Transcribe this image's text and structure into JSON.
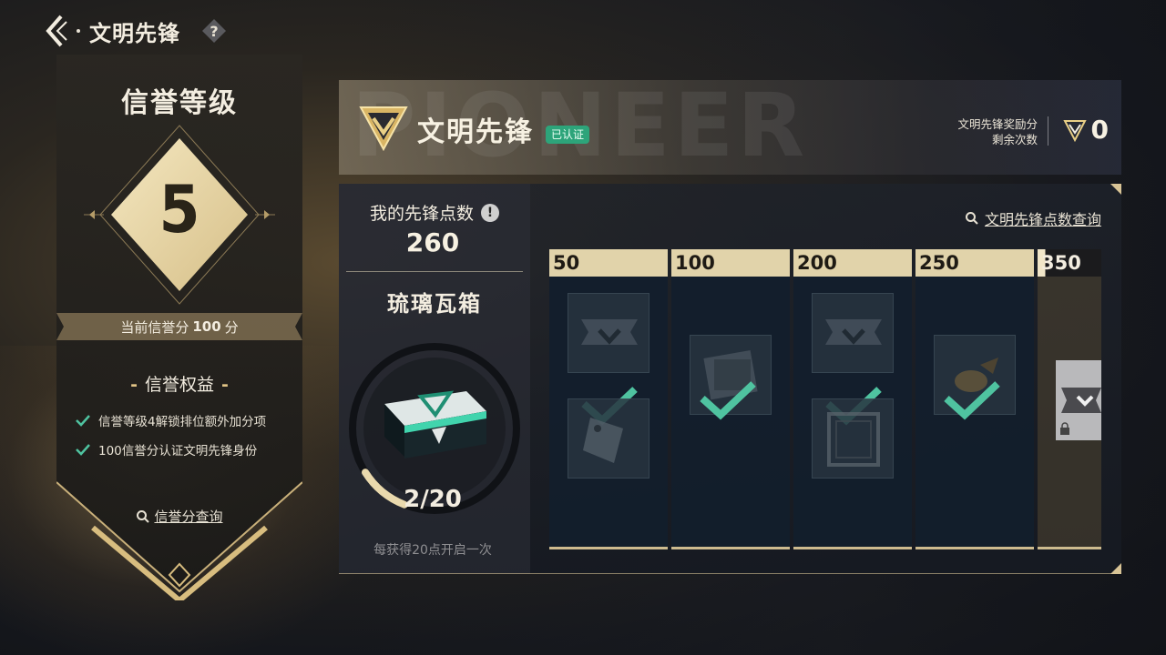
{
  "topbar": {
    "title": "文明先锋"
  },
  "rank": {
    "title": "信誉等级",
    "level": "5",
    "score_prefix": "当前信誉分",
    "score_value": "100",
    "score_suffix": "分",
    "benefits_title": "信誉权益",
    "benefits": [
      "信誉等级4解锁排位额外加分项",
      "100信誉分认证文明先锋身份"
    ],
    "query_label": "信誉分查询"
  },
  "banner": {
    "watermark": "PIONEER",
    "title": "文明先锋",
    "badge": "已认证",
    "reward_label_line1": "文明先锋奖励分",
    "reward_label_line2": "剩余次数",
    "reward_count": "0"
  },
  "points": {
    "label": "我的先锋点数",
    "info_glyph": "!",
    "value": "260",
    "box_name": "琉璃瓦箱",
    "progress_text": "2/20",
    "progress_fraction": 0.1,
    "hint": "每获得20点开启一次",
    "query_label": "文明先锋点数查询"
  },
  "tiers": [
    {
      "threshold": "50",
      "rewards": 2,
      "claimed": true
    },
    {
      "threshold": "100",
      "rewards": 1,
      "claimed": true
    },
    {
      "threshold": "200",
      "rewards": 2,
      "claimed": true
    },
    {
      "threshold": "250",
      "rewards": 1,
      "claimed": true
    },
    {
      "threshold": "350",
      "rewards": 1,
      "claimed": false
    }
  ],
  "colors": {
    "accent_gold": "#e1d3aa",
    "check_green": "#4fc3a0",
    "verified_green": "#2da47a"
  }
}
